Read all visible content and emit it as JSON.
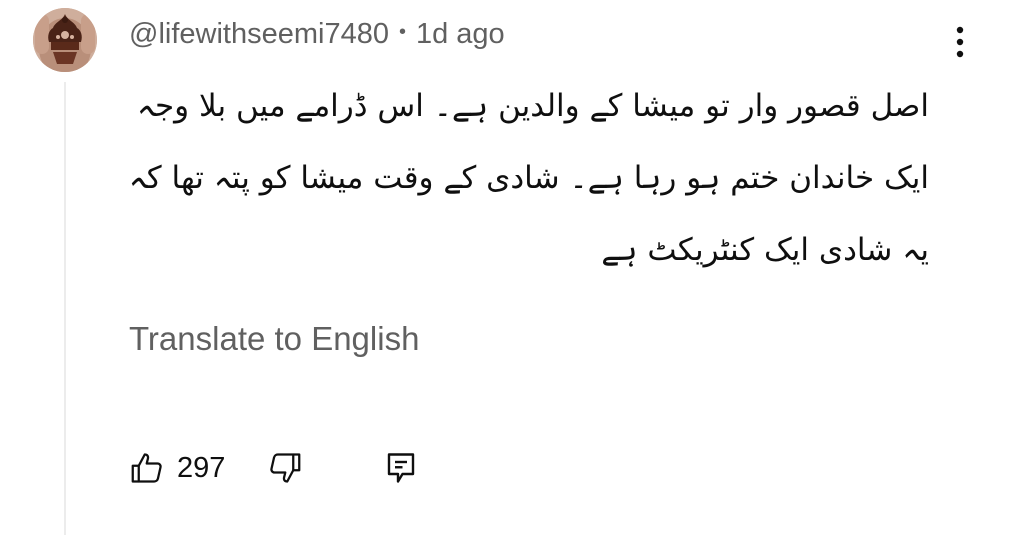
{
  "comment": {
    "author": "@lifewithseemi7480",
    "separator": "•",
    "timestamp": "1d ago",
    "body_lines": [
      "اصل قصور وار تو میشا کے والدین ہے۔ اس ڈرامے میں بلا وجہ",
      "ایک خاندان ختم ہو رہا ہے۔ شادی کے وقت میشا کو پتہ تھا کہ",
      "یہ شادی ایک کنٹریکٹ ہے"
    ],
    "translate_label": "Translate to English",
    "like_count": "297"
  },
  "icons": {
    "avatar": "avatar-image",
    "more": "more-vertical-icon",
    "like": "thumbs-up-icon",
    "dislike": "thumbs-down-icon",
    "reply": "reply-comment-icon"
  },
  "colors": {
    "primary_text": "#0f0f0f",
    "secondary_text": "#606060",
    "thread_line": "#ececec"
  }
}
